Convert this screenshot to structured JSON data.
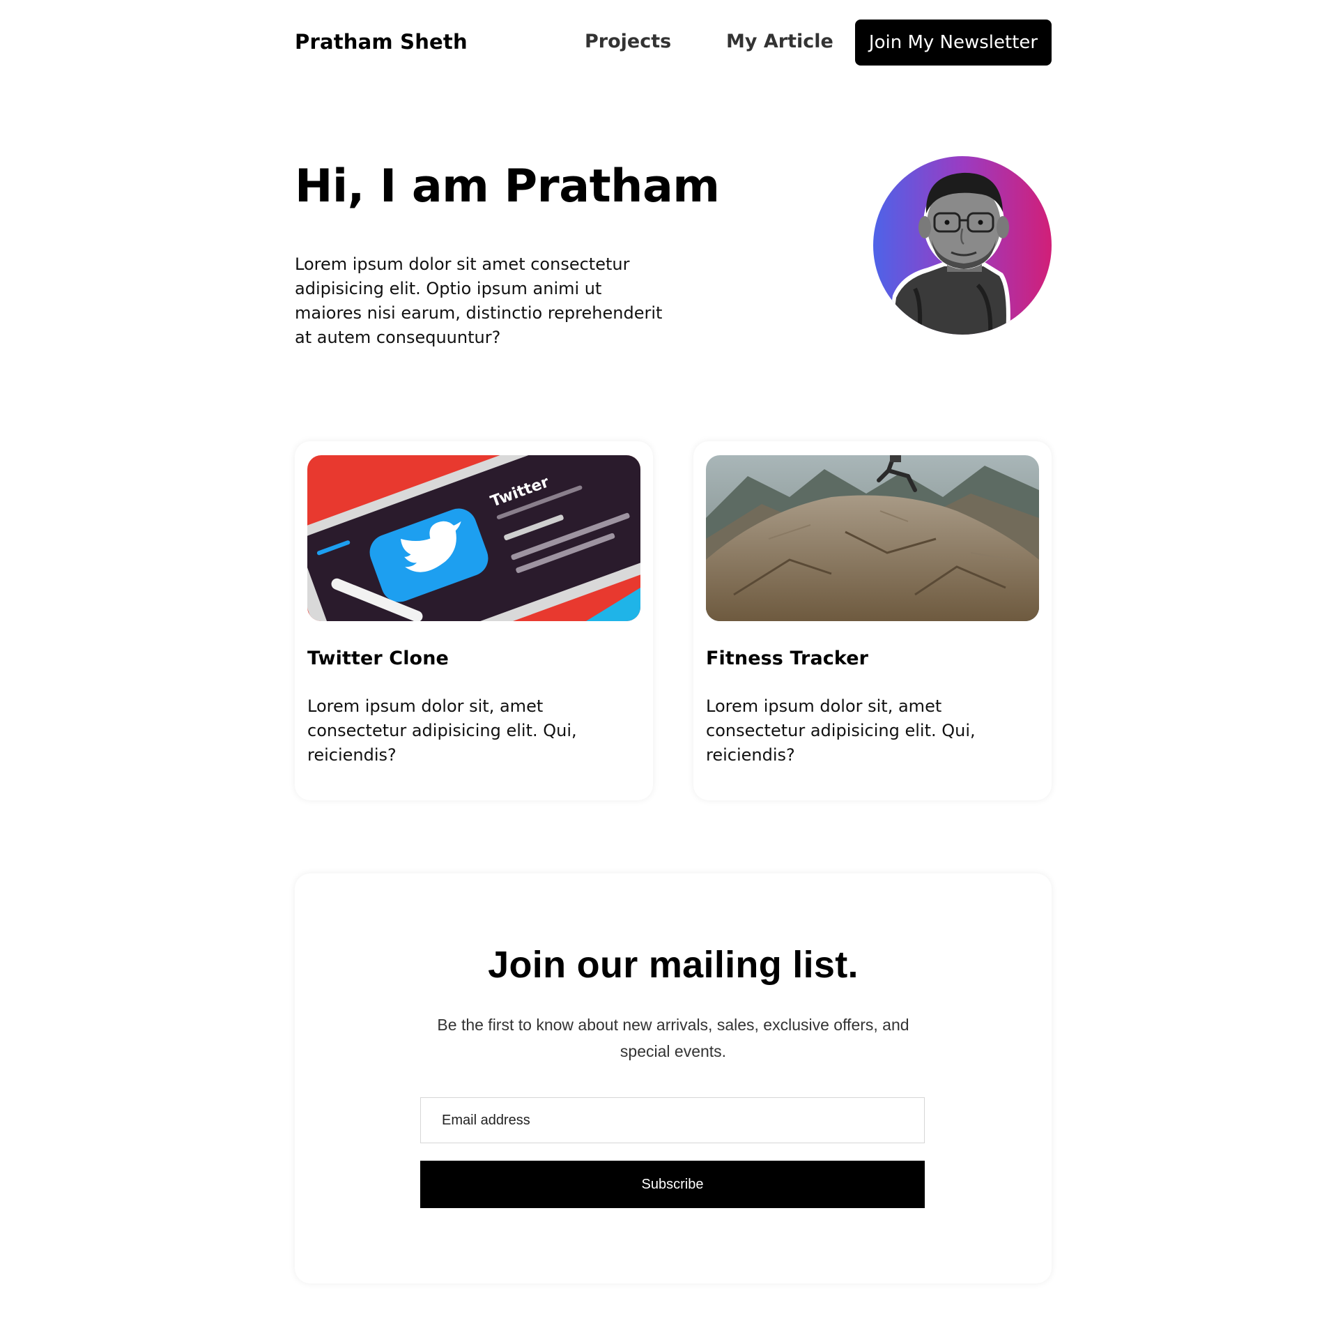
{
  "nav": {
    "brand": "Pratham Sheth",
    "links": [
      {
        "label": "Projects"
      },
      {
        "label": "My Article"
      }
    ],
    "cta_label": "Join My Newsletter"
  },
  "hero": {
    "title": "Hi, I am Pratham",
    "description": "Lorem ipsum dolor sit amet consectetur adipisicing elit. Optio ipsum animi ut maiores nisi earum, distinctio reprehenderit at autem consequuntur?",
    "avatar_gradient": [
      "#4e63e8",
      "#9a3cc2",
      "#d11f78"
    ]
  },
  "projects": [
    {
      "title": "Twitter Clone",
      "description": "Lorem ipsum dolor sit, amet consectetur adipisicing elit. Qui, reiciendis?",
      "image": "twitter-app-on-phone",
      "image_text": {
        "app_name": "Twitter"
      }
    },
    {
      "title": "Fitness Tracker",
      "description": "Lorem ipsum dolor sit, amet consectetur adipisicing elit. Qui, reiciendis?",
      "image": "runner-on-mountain-rock"
    }
  ],
  "mailing": {
    "title": "Join our mailing list.",
    "description": "Be the first to know about new arrivals, sales, exclusive offers, and special events.",
    "email_placeholder": "Email address",
    "subscribe_label": "Subscribe"
  },
  "colors": {
    "primary": "#000000",
    "background": "#ffffff",
    "text_muted": "#333333"
  }
}
